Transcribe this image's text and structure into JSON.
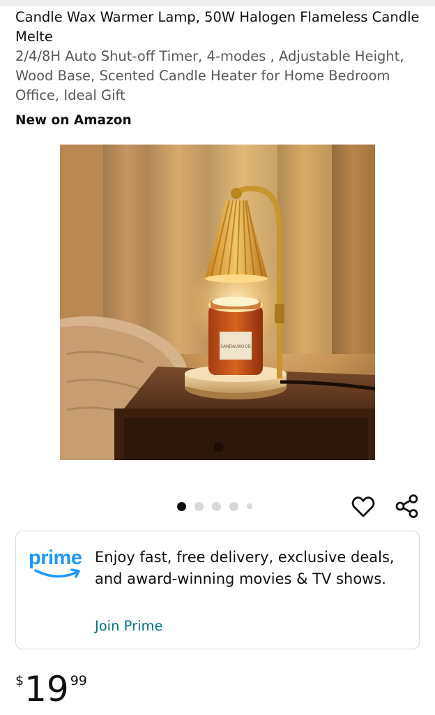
{
  "product": {
    "title": "Candle Wax Warmer Lamp, 50W Halogen Flameless Candle Melte",
    "subtitle": "2/4/8H Auto Shut-off Timer, 4-modes , Adjustable Height, Wood Base, Scented Candle Heater for Home Bedroom Office, Ideal Gift",
    "badge": "New on Amazon",
    "image": {
      "alt": "Gold candle warmer lamp with fluted amber shade over a lit candle jar on a wooden nightstand",
      "jar_label": "SANDALWOOD"
    }
  },
  "carousel": {
    "count": 5,
    "active_index": 0
  },
  "actions": {
    "wishlist_icon": "heart-outline-icon",
    "share_icon": "share-icon"
  },
  "prime": {
    "logo_text": "prime",
    "message": "Enjoy fast, free delivery, exclusive deals, and award-winning movies & TV shows.",
    "link": "Join Prime"
  },
  "price": {
    "symbol": "$",
    "whole": "19",
    "fraction": "99"
  },
  "colors": {
    "prime_blue": "#1a98ff",
    "link_teal": "#007185",
    "text_primary": "#0f1111",
    "text_secondary": "#565959",
    "border": "#d5d9d9"
  }
}
